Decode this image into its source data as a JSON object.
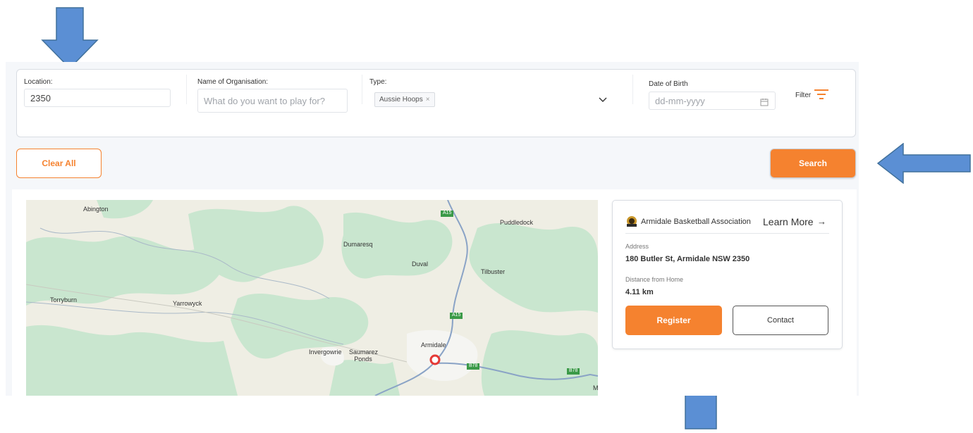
{
  "filters": {
    "location": {
      "label": "Location:",
      "value": "2350"
    },
    "organisation": {
      "label": "Name of Organisation:",
      "placeholder": "What do you want to play for?"
    },
    "type": {
      "label": "Type:",
      "selected_tag": "Aussie Hoops",
      "tag_remove": "×"
    },
    "dob": {
      "label": "Date of Birth",
      "placeholder": "dd-mm-yyyy"
    },
    "filter_label": "Filter"
  },
  "actions": {
    "clear_label": "Clear All",
    "search_label": "Search"
  },
  "map": {
    "places": [
      "Abington",
      "Puddledock",
      "Dumaresq",
      "Duval",
      "Tilbuster",
      "Torryburn",
      "Yarrowyck",
      "Armidale",
      "Invergowrie",
      "Saumarez Ponds",
      "M"
    ],
    "road_labels": [
      "A15",
      "A15",
      "B78",
      "B78"
    ]
  },
  "club": {
    "name": "Armidale Basketball Association",
    "learn_more": "Learn More",
    "arrow": "→",
    "address_label": "Address",
    "address": "180 Butler St, Armidale NSW 2350",
    "distance_label": "Distance from Home",
    "distance": "4.11 km",
    "register_label": "Register",
    "contact_label": "Contact"
  },
  "colors": {
    "accent": "#f5822f",
    "annotation_arrow": "#5b8fd4",
    "map_green": "#c9e6cf",
    "map_land": "#efeee4",
    "map_road": "#8aa3c6"
  }
}
